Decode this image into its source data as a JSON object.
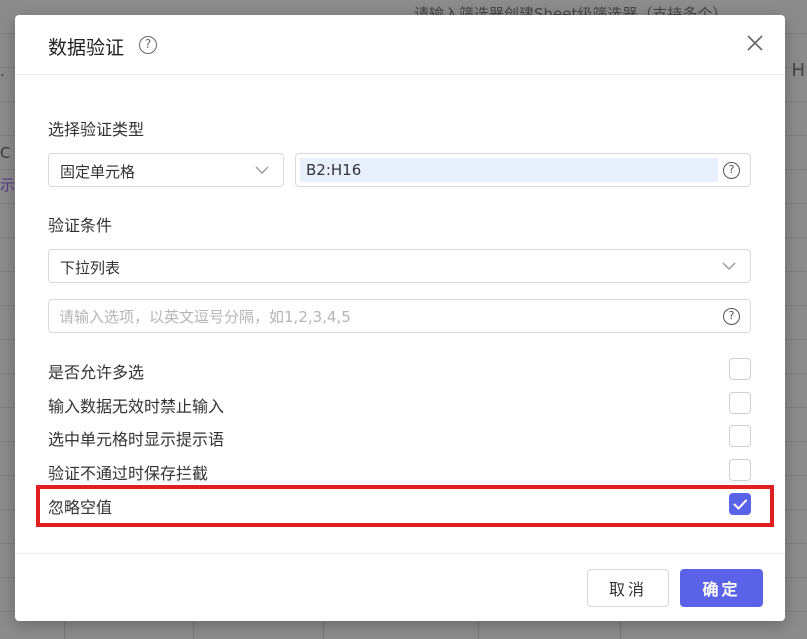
{
  "background": {
    "top_text": "请输入筛选器创建Sheet级筛选器（支持多个）",
    "left_texts": [
      ".",
      "C",
      "示指"
    ],
    "right_text": "H"
  },
  "dialog": {
    "title": "数据验证",
    "title_help_glyph": "?",
    "sections": {
      "validation_type_label": "选择验证类型",
      "validation_type_value": "固定单元格",
      "range_value": "B2:H16",
      "condition_label": "验证条件",
      "condition_value": "下拉列表",
      "options_placeholder": "请输入选项，以英文逗号分隔，如1,2,3,4,5"
    },
    "checkboxes": [
      {
        "label": "是否允许多选",
        "checked": false
      },
      {
        "label": "输入数据无效时禁止输入",
        "checked": false
      },
      {
        "label": "选中单元格时显示提示语",
        "checked": false
      },
      {
        "label": "验证不通过时保存拦截",
        "checked": false
      },
      {
        "label": "忽略空值",
        "checked": true
      }
    ],
    "footer": {
      "cancel_label": "取消",
      "ok_label": "确定"
    }
  },
  "colors": {
    "accent": "#5a63e8",
    "highlight": "#e02020",
    "range_field_bg": "#e8f0fe"
  },
  "icons": {
    "close": "close-icon",
    "chevron": "chevron-down-icon",
    "help": "help-icon",
    "check": "check-icon"
  }
}
